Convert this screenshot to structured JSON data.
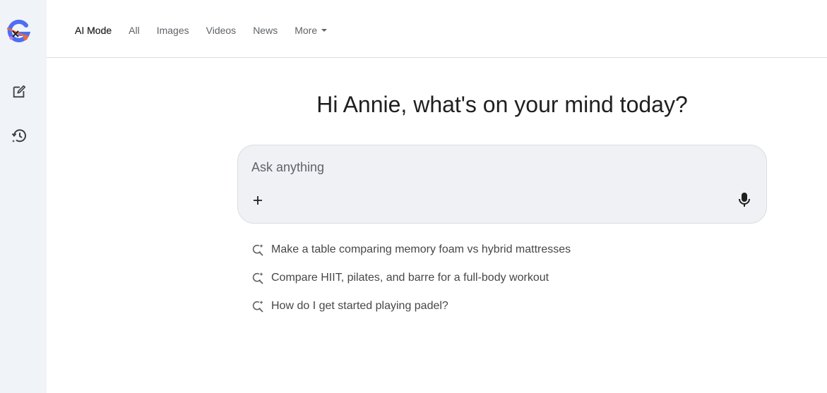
{
  "sidebar": {
    "logo_icon": "google-logo-icon",
    "new_chat_icon": "edit-icon",
    "history_icon": "history-icon"
  },
  "tabs": [
    {
      "label": "AI Mode",
      "active": true
    },
    {
      "label": "All"
    },
    {
      "label": "Images"
    },
    {
      "label": "Videos"
    },
    {
      "label": "News"
    },
    {
      "label": "More"
    }
  ],
  "main": {
    "greeting": "Hi Annie, what's on your mind today?",
    "search": {
      "placeholder": "Ask anything",
      "value": "",
      "plus_icon": "plus-icon",
      "mic_icon": "mic-icon"
    },
    "suggestions": [
      {
        "text": "Make a table comparing memory foam vs hybrid mattresses",
        "icon": "search-sparkle-icon"
      },
      {
        "text": "Compare HIIT, pilates, and barre for a full-body workout",
        "icon": "search-sparkle-icon"
      },
      {
        "text": "How do I get started playing padel?",
        "icon": "search-sparkle-icon"
      }
    ]
  },
  "colors": {
    "sidebar_bg": "#f0f4f9",
    "searchbox_bg": "#f0f1f5",
    "text": "#1f1f1f",
    "muted": "#5f6368"
  }
}
